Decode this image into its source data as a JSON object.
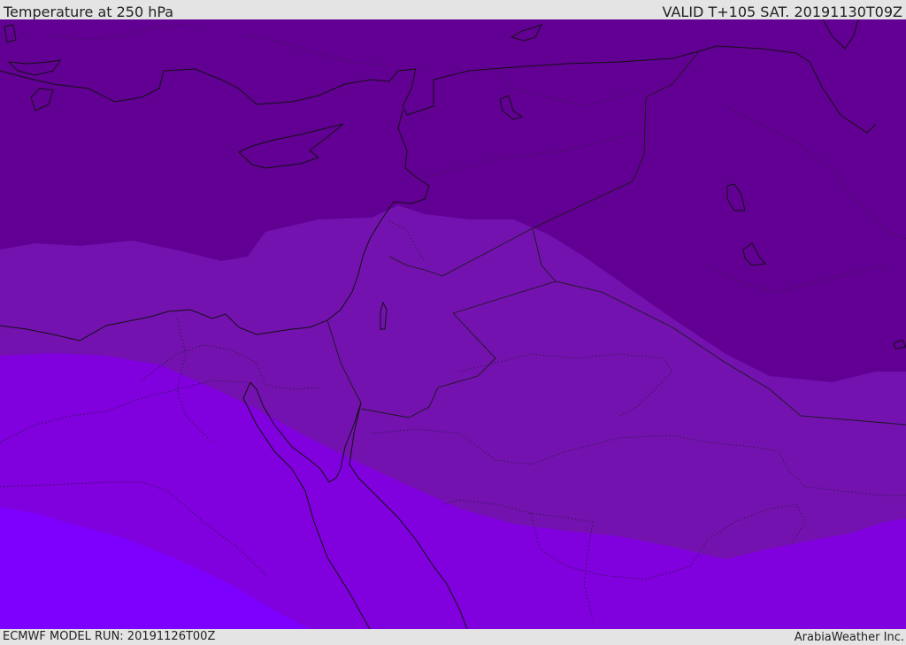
{
  "header": {
    "title": "Temperature at 250 hPa",
    "valid": "VALID T+105 SAT. 20191130T09Z"
  },
  "footer": {
    "model_run": "ECMWF MODEL RUN: 20191126T00Z",
    "credit": "ArabiaWeather Inc."
  },
  "colors": {
    "band_darkest": "#630094",
    "band_mid": "#7412b0",
    "band_light": "#8000de",
    "band_lightest": "#7d00ff",
    "coastline": "#111111"
  }
}
